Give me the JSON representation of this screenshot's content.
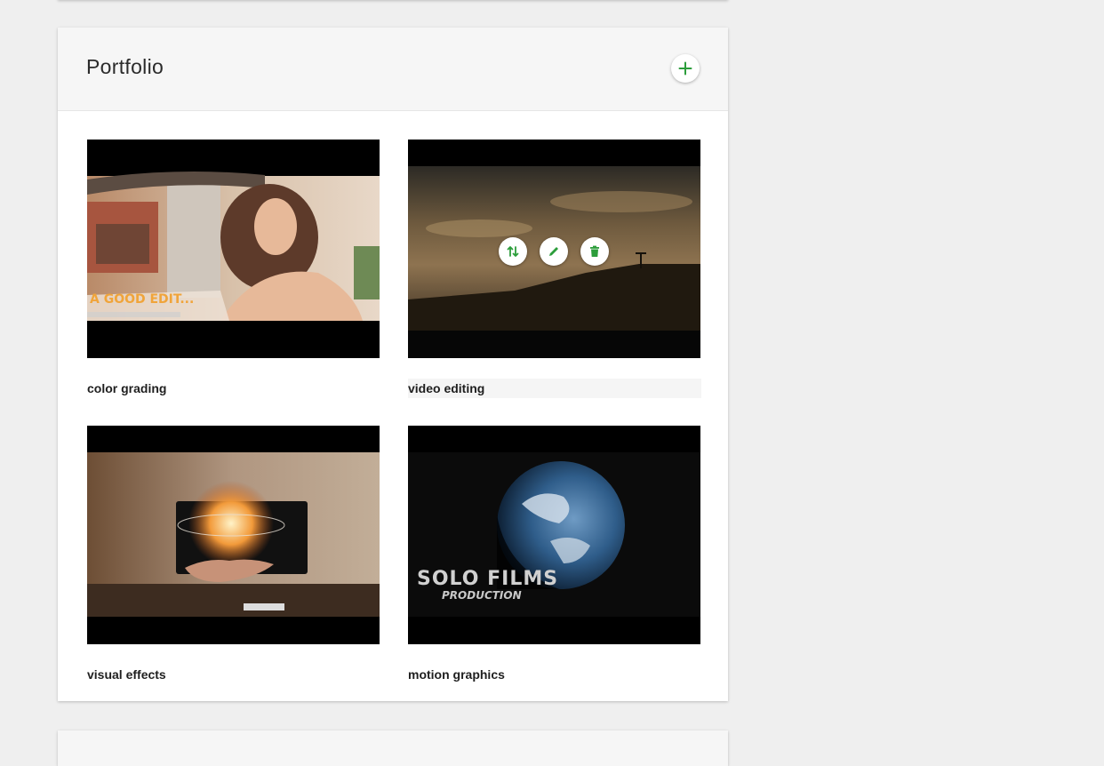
{
  "portfolio": {
    "title": "Portfolio",
    "add_icon": "plus-icon",
    "accent_color": "#2c9d3b",
    "items": [
      {
        "caption": "color grading",
        "overlay_text": "A GOOD EDIT...",
        "overlay_color": "#f0a43a"
      },
      {
        "caption": "video editing",
        "actions": [
          {
            "icon": "reorder-icon"
          },
          {
            "icon": "edit-icon"
          },
          {
            "icon": "delete-icon"
          }
        ]
      },
      {
        "caption": "visual effects"
      },
      {
        "caption": "motion graphics",
        "overlay_title": "SOLO FILMS",
        "overlay_subtitle": "PRODUCTION"
      }
    ]
  }
}
